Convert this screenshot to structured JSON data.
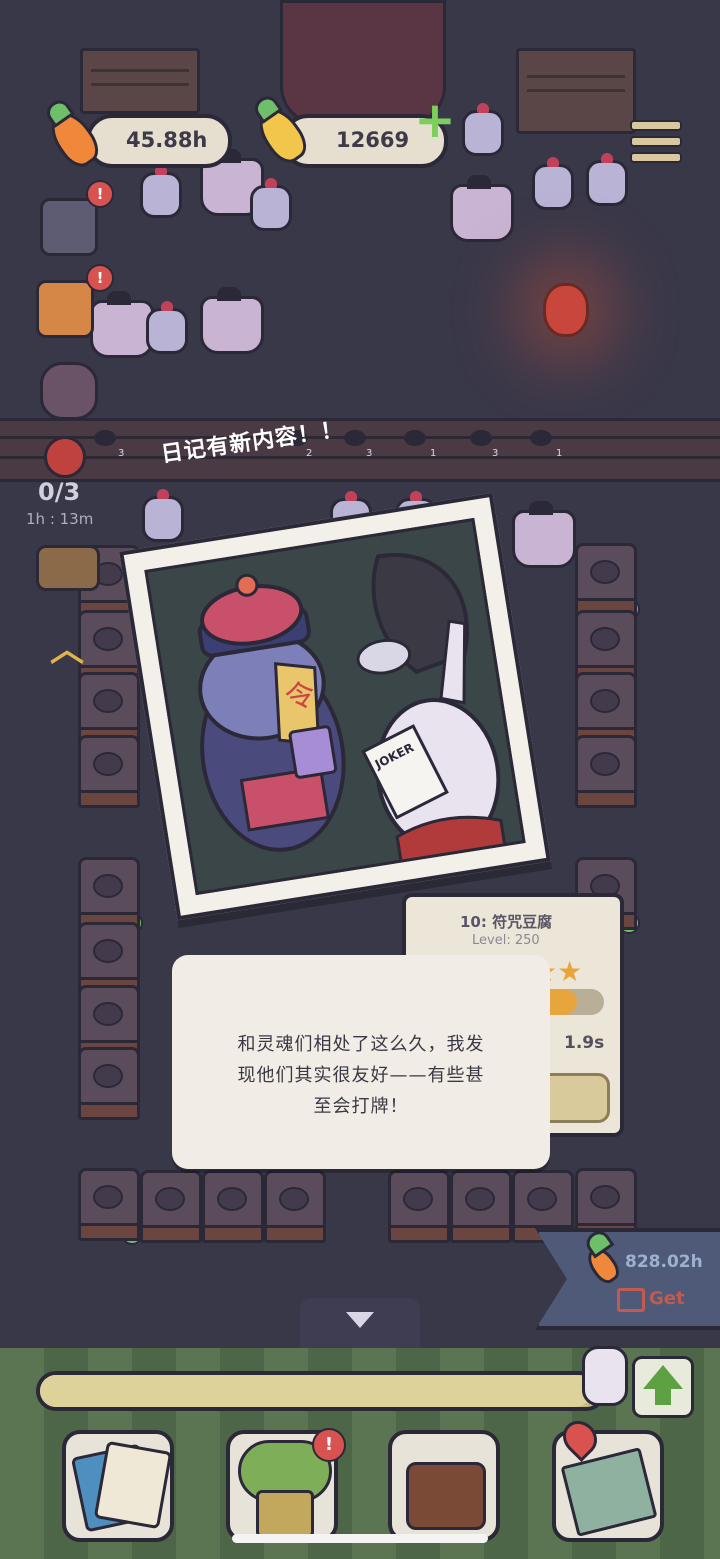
{
  "hud": {
    "carrots_rate": "45.88h",
    "gold_carrots": "12669"
  },
  "side": {
    "cart_counter": "0/3",
    "cart_timer": "1h : 13m",
    "badge": "!"
  },
  "belt_counts": [
    "3",
    "2",
    "3",
    "1",
    "3",
    "1"
  ],
  "notification": "日记有新内容！！",
  "photo": {
    "card_label": "JOKER",
    "talisman_char": "令"
  },
  "info_card": {
    "title": "10: 符咒豆腐",
    "level": "Level: 250",
    "time": "1.9s",
    "stars": 3,
    "progress": 0.85
  },
  "dialog": {
    "line1": "和灵魂们相处了这么久，我发",
    "line2": "现他们其实很友好——有些甚",
    "line3": "至会打牌！"
  },
  "reward": {
    "value": "828.02h",
    "label": "Get"
  },
  "bottom": {
    "progress": 0.98
  },
  "colors": {
    "background": "#393849",
    "accent_green": "#7ccf5a",
    "star": "#e7a53e",
    "reward_get": "#c25a52"
  }
}
